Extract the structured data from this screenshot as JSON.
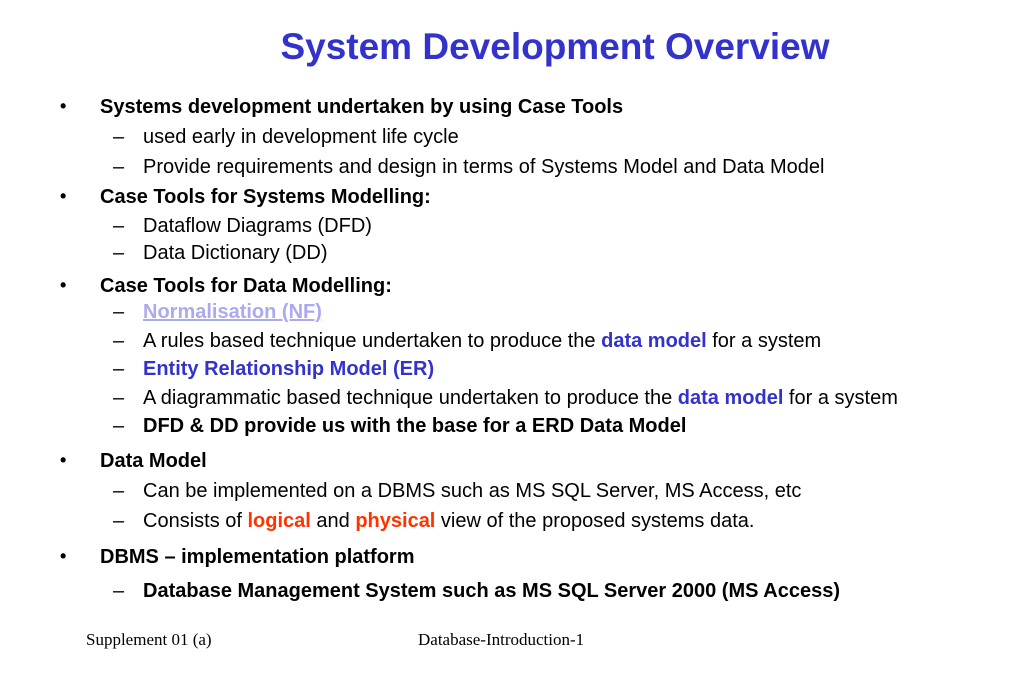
{
  "title": "System Development Overview",
  "bullet_symbol": "•",
  "dash_symbol": "–",
  "b1": {
    "text": "Systems development undertaken by using Case Tools",
    "sub1": "used early in development life cycle",
    "sub2": "Provide requirements and design in terms of Systems Model and Data Model"
  },
  "b2": {
    "text": "Case Tools for Systems Modelling:",
    "sub1": "Dataflow Diagrams (DFD)",
    "sub2": "Data Dictionary (DD)"
  },
  "b3": {
    "text": "Case Tools for Data Modelling:",
    "sub1_link": "Normalisation (NF)",
    "sub2_pre": "A rules based technique undertaken to produce the ",
    "sub2_em": "data model",
    "sub2_post": " for a system",
    "sub3": "Entity Relationship Model (ER)",
    "sub4_pre": "A diagrammatic based technique undertaken to produce the ",
    "sub4_em": "data model",
    "sub4_post": " for a system",
    "sub5": "DFD & DD provide us with the base for a ERD Data Model"
  },
  "b4": {
    "text": "Data Model",
    "sub1": "Can be implemented on a DBMS such as MS SQL Server, MS Access, etc",
    "sub2_pre": "Consists of ",
    "sub2_em1": "logical",
    "sub2_mid": " and ",
    "sub2_em2": "physical",
    "sub2_post": " view of the proposed systems data."
  },
  "b5": {
    "text": "DBMS – implementation platform",
    "sub1": "Database Management System such as MS SQL Server 2000 (MS Access)"
  },
  "footer": {
    "left": "Supplement 01 (a)",
    "center": "Database-Introduction-1"
  },
  "colors": {
    "title": "#3333cc",
    "emphasis_blue": "#3333cc",
    "emphasis_red": "#ff3300",
    "link": "#aaaaee"
  }
}
